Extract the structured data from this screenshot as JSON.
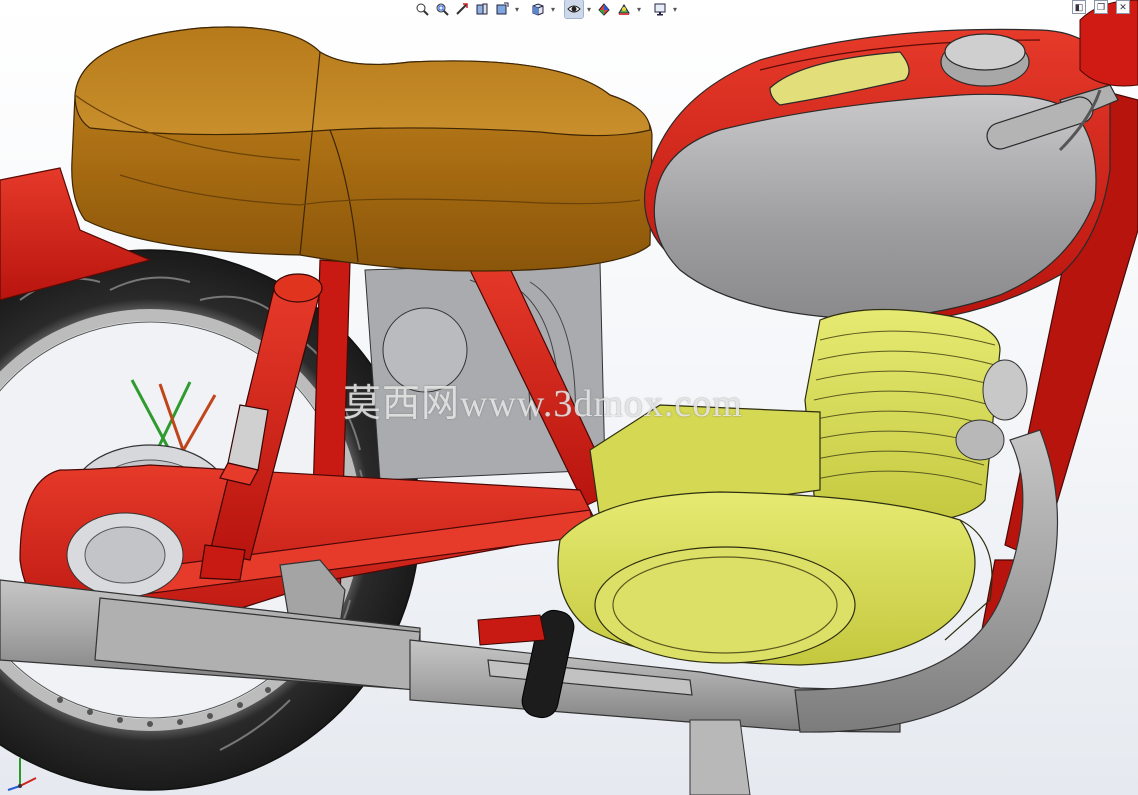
{
  "watermark": {
    "text": "莫西网www.3dmox.com"
  },
  "toolbar": {
    "tools": [
      {
        "name": "zoom-to-fit-icon"
      },
      {
        "name": "zoom-to-area-icon"
      },
      {
        "name": "previous-view-icon"
      },
      {
        "name": "section-view-icon"
      },
      {
        "name": "dynamic-annotation-icon"
      },
      {
        "name": "view-orientation-icon"
      },
      {
        "name": "display-style-icon"
      },
      {
        "name": "hide-show-items-icon"
      },
      {
        "name": "edit-appearance-icon"
      },
      {
        "name": "apply-scene-icon"
      },
      {
        "name": "view-settings-icon"
      }
    ]
  },
  "colors": {
    "frame_red": "#d01a14",
    "seat_brown": "#a86c12",
    "tank_grey": "#9a9a9c",
    "engine_yellow": "#d8dc54",
    "tire_black": "#2a2a2a",
    "pipe_grey": "#a4a4a4"
  }
}
